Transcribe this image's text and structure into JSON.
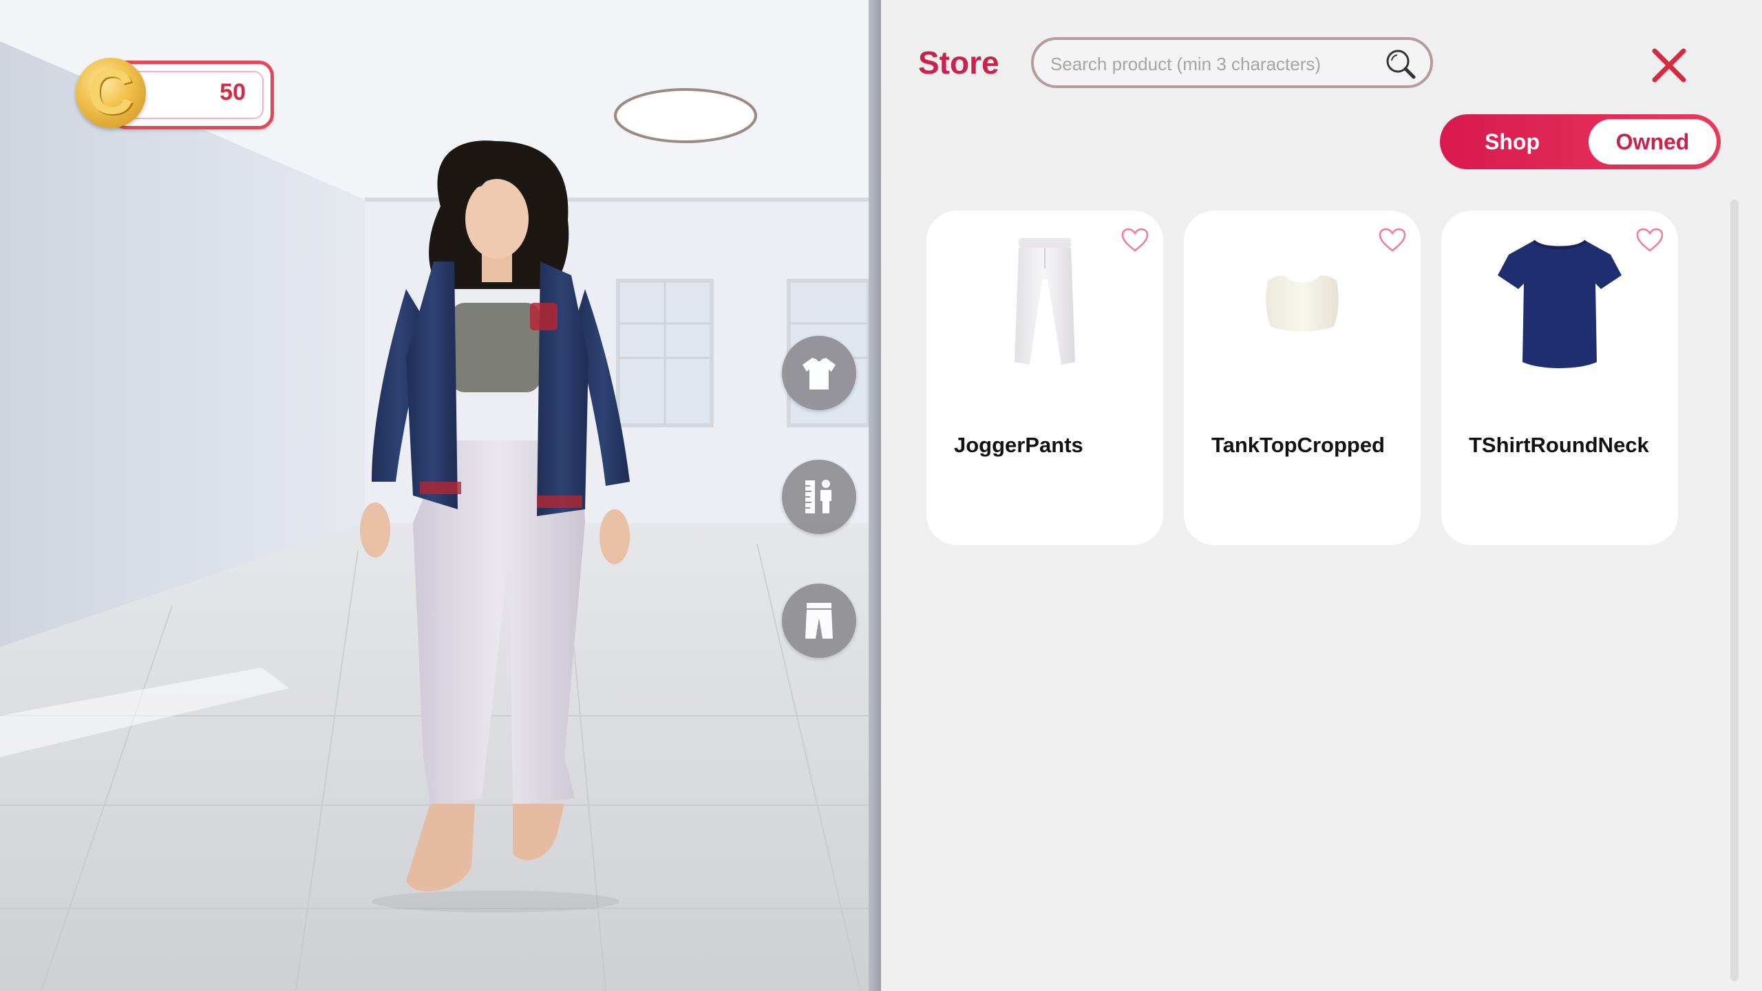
{
  "currency": {
    "value": "50",
    "icon": "coin-c-icon",
    "accent": "#e0495a"
  },
  "side_buttons": [
    {
      "name": "tops-category-button",
      "icon": "tshirt-icon"
    },
    {
      "name": "body-measurements-button",
      "icon": "ruler-person-icon"
    },
    {
      "name": "bottoms-category-button",
      "icon": "pants-icon"
    }
  ],
  "store": {
    "title": "Store",
    "search": {
      "placeholder": "Search product (min 3 characters)",
      "value": ""
    },
    "tabs": {
      "shop": "Shop",
      "owned": "Owned",
      "selected": "Shop"
    },
    "products": [
      {
        "name": "JoggerPants",
        "icon": "jogger-pants-thumbnail",
        "favorite": false
      },
      {
        "name": "TankTopCropped",
        "icon": "cropped-tank-top-thumbnail",
        "favorite": false
      },
      {
        "name": "TShirtRoundNeck",
        "icon": "round-neck-tshirt-thumbnail",
        "favorite": false
      }
    ]
  },
  "colors": {
    "brand": "#c8234a",
    "toggle": "#e02a54",
    "panel_bg": "#efefef",
    "favorite_outline": "#f07a9a"
  }
}
